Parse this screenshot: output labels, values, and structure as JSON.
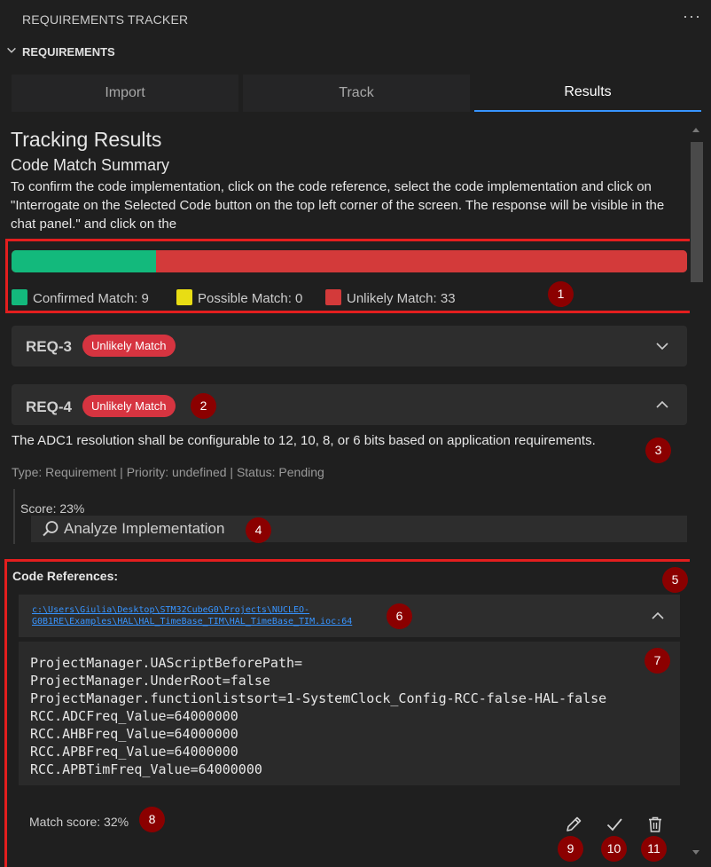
{
  "window": {
    "title": "REQUIREMENTS TRACKER",
    "more_label": "···"
  },
  "section": {
    "label": "REQUIREMENTS"
  },
  "tabs": [
    {
      "label": "Import",
      "active": false
    },
    {
      "label": "Track",
      "active": false
    },
    {
      "label": "Results",
      "active": true
    }
  ],
  "results": {
    "title": "Tracking Results",
    "subtitle": "Code Match Summary",
    "intro": "To confirm the code implementation, click on the code reference, select the code implementation and click on \"Interrogate on the Selected Code button on the top left corner of the screen. The response will be visible in the chat panel.\" and click on the",
    "summary": {
      "confirmed": 9,
      "possible": 0,
      "unlikely": 33,
      "legend": [
        {
          "label": "Confirmed Match: 9",
          "color": "#13b97c"
        },
        {
          "label": "Possible Match: 0",
          "color": "#e8dd14"
        },
        {
          "label": "Unlikely Match: 33",
          "color": "#d33a3a"
        }
      ]
    }
  },
  "requirements": [
    {
      "id": "REQ-3",
      "badge": "Unlikely Match",
      "expanded": false
    },
    {
      "id": "REQ-4",
      "badge": "Unlikely Match",
      "expanded": true,
      "description": "The ADC1 resolution shall be configurable to 12, 10, 8, or 6 bits based on application requirements.",
      "meta": "Type: Requirement | Priority: undefined | Status: Pending",
      "score": "Score: 23%",
      "analyze_label": "Analyze Implementation",
      "code_refs_title": "Code References:",
      "code_ref": {
        "link_line1": "c:\\Users\\Giulia\\Desktop\\STM32CubeG0\\Projects\\NUCLEO-",
        "link_line2": "G0B1RE\\Examples\\HAL\\HAL_TimeBase_TIM\\HAL_TimeBase_TIM.ioc:64",
        "code_lines": [
          "ProjectManager.UAScriptBeforePath=",
          "ProjectManager.UnderRoot=false",
          "ProjectManager.functionlistsort=1-SystemClock_Config-RCC-false-HAL-false",
          "RCC.ADCFreq_Value=64000000",
          "RCC.AHBFreq_Value=64000000",
          "RCC.APBFreq_Value=64000000",
          "RCC.APBTimFreq_Value=64000000"
        ],
        "match_score": "Match score: 32%"
      }
    }
  ],
  "markers": [
    "1",
    "2",
    "3",
    "4",
    "5",
    "6",
    "7",
    "8",
    "9",
    "10",
    "11"
  ],
  "icons": [
    "chevron-down-icon",
    "chevron-up-icon",
    "search-icon",
    "pencil-icon",
    "check-icon",
    "trash-icon"
  ]
}
